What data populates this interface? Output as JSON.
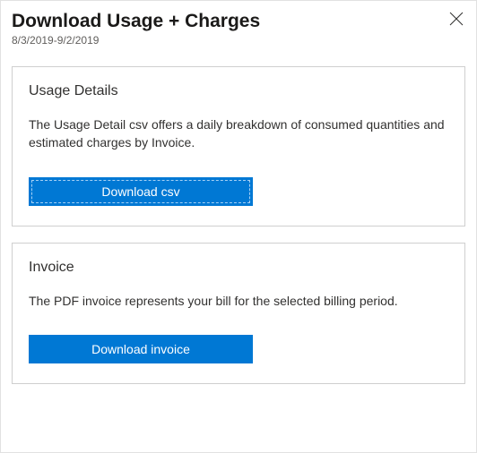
{
  "header": {
    "title": "Download Usage + Charges",
    "date_range": "8/3/2019-9/2/2019"
  },
  "usage_card": {
    "title": "Usage Details",
    "description": "The Usage Detail csv offers a daily breakdown of consumed quantities and estimated charges by Invoice.",
    "button_label": "Download csv"
  },
  "invoice_card": {
    "title": "Invoice",
    "description": "The PDF invoice represents your bill for the selected billing period.",
    "button_label": "Download invoice"
  }
}
